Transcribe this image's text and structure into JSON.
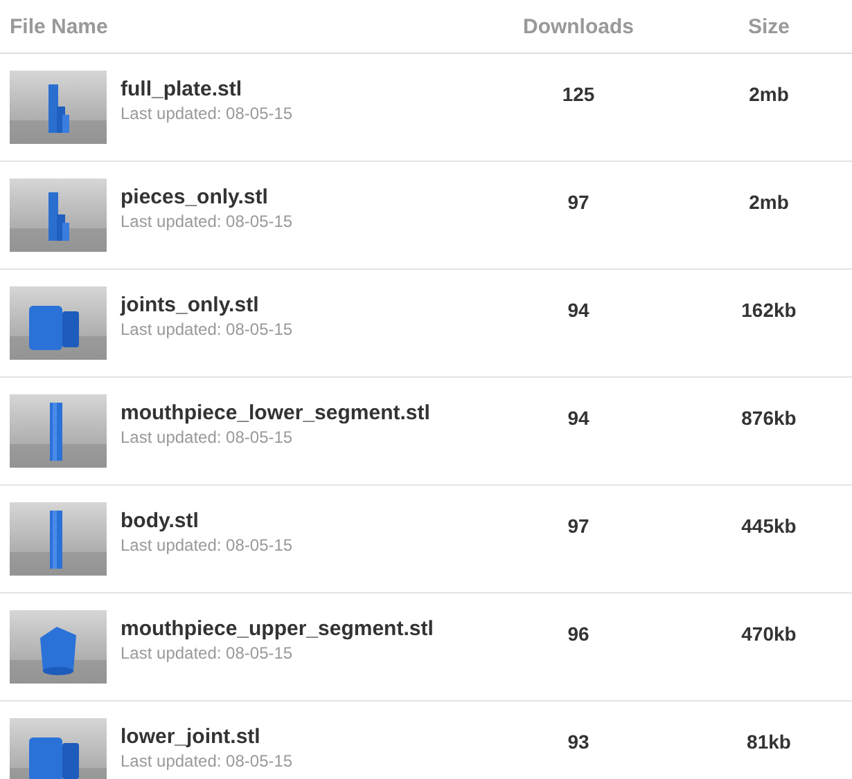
{
  "table": {
    "columns": [
      "File Name",
      "Downloads",
      "Size"
    ],
    "rows": [
      {
        "name": "full_plate.stl",
        "updated": "Last updated: 08-05-15",
        "downloads": "125",
        "size": "2mb"
      },
      {
        "name": "pieces_only.stl",
        "updated": "Last updated: 08-05-15",
        "downloads": "97",
        "size": "2mb"
      },
      {
        "name": "joints_only.stl",
        "updated": "Last updated: 08-05-15",
        "downloads": "94",
        "size": "162kb"
      },
      {
        "name": "mouthpiece_lower_segment.stl",
        "updated": "Last updated: 08-05-15",
        "downloads": "94",
        "size": "876kb"
      },
      {
        "name": "body.stl",
        "updated": "Last updated: 08-05-15",
        "downloads": "97",
        "size": "445kb"
      },
      {
        "name": "mouthpiece_upper_segment.stl",
        "updated": "Last updated: 08-05-15",
        "downloads": "96",
        "size": "470kb"
      },
      {
        "name": "lower_joint.stl",
        "updated": "Last updated: 08-05-15",
        "downloads": "93",
        "size": "81kb"
      }
    ]
  }
}
